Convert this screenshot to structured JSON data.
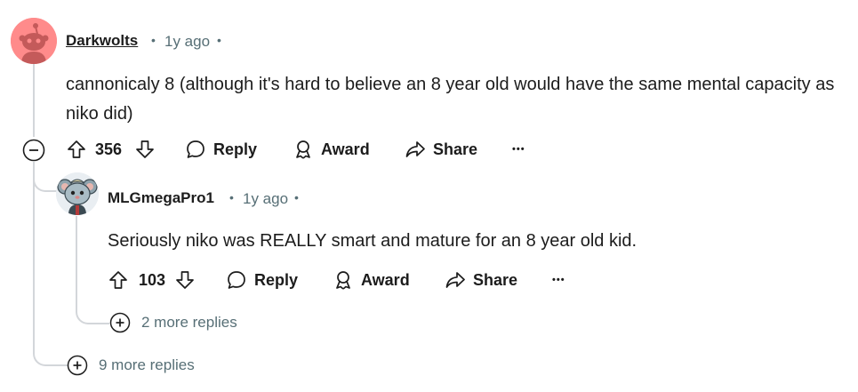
{
  "comment": {
    "username": "Darkwolts",
    "separator": "•",
    "time": "1y ago",
    "time_trailing": "•",
    "text": "cannonicaly 8 (although it's hard to believe an 8 year old would have the same mental capacity as niko did)",
    "votes": "356",
    "reply_label": "Reply",
    "award_label": "Award",
    "share_label": "Share",
    "more_label": "•••",
    "more_replies": "9 more replies"
  },
  "reply": {
    "username": "MLGmegaPro1",
    "separator": "•",
    "time": "1y ago",
    "time_trailing": "•",
    "text": "Seriously niko was REALLY smart and mature for an 8 year old kid.",
    "votes": "103",
    "reply_label": "Reply",
    "award_label": "Award",
    "share_label": "Share",
    "more_label": "•••",
    "more_replies": "2 more replies"
  },
  "colors": {
    "avatar_pink": "#ff8b8b",
    "thread_line": "#d3d6da",
    "meta_text": "#576f76"
  },
  "icons": [
    "collapse-icon",
    "upvote-icon",
    "downvote-icon",
    "reply-icon",
    "award-icon",
    "share-icon",
    "more-icon",
    "expand-icon",
    "snoo-avatar",
    "mascot-avatar"
  ]
}
